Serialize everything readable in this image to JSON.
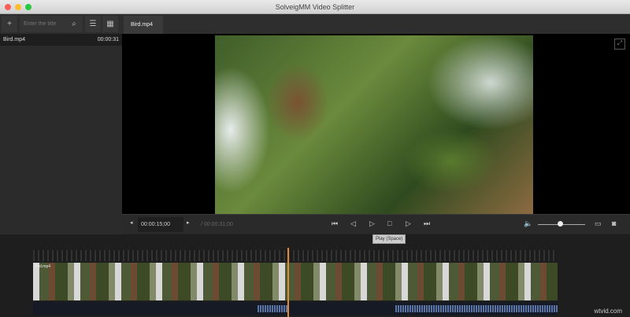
{
  "window": {
    "title": "SolveigMM Video Splitter"
  },
  "toolbar": {
    "add": "+",
    "search_placeholder": "Enter the title",
    "search_icon": "⌕",
    "list_icon": "☰",
    "grid_icon": "▦",
    "tab": "Bird.mp4"
  },
  "sidebar": {
    "items": [
      {
        "name": "Bird.mp4",
        "duration": "00:00:31"
      }
    ]
  },
  "controls": {
    "prev": "◂",
    "time": "00:00:15;00",
    "next": "▸",
    "duration": "/ 00:00:31;00",
    "tooltip": "Play (Space)",
    "volume": 0.6
  },
  "timeline": {
    "clip_label": "Bird.mp4"
  },
  "watermark": "wtvid.com",
  "colors": {
    "playhead": "#e08a3a",
    "waveform": "#5a74a8"
  }
}
